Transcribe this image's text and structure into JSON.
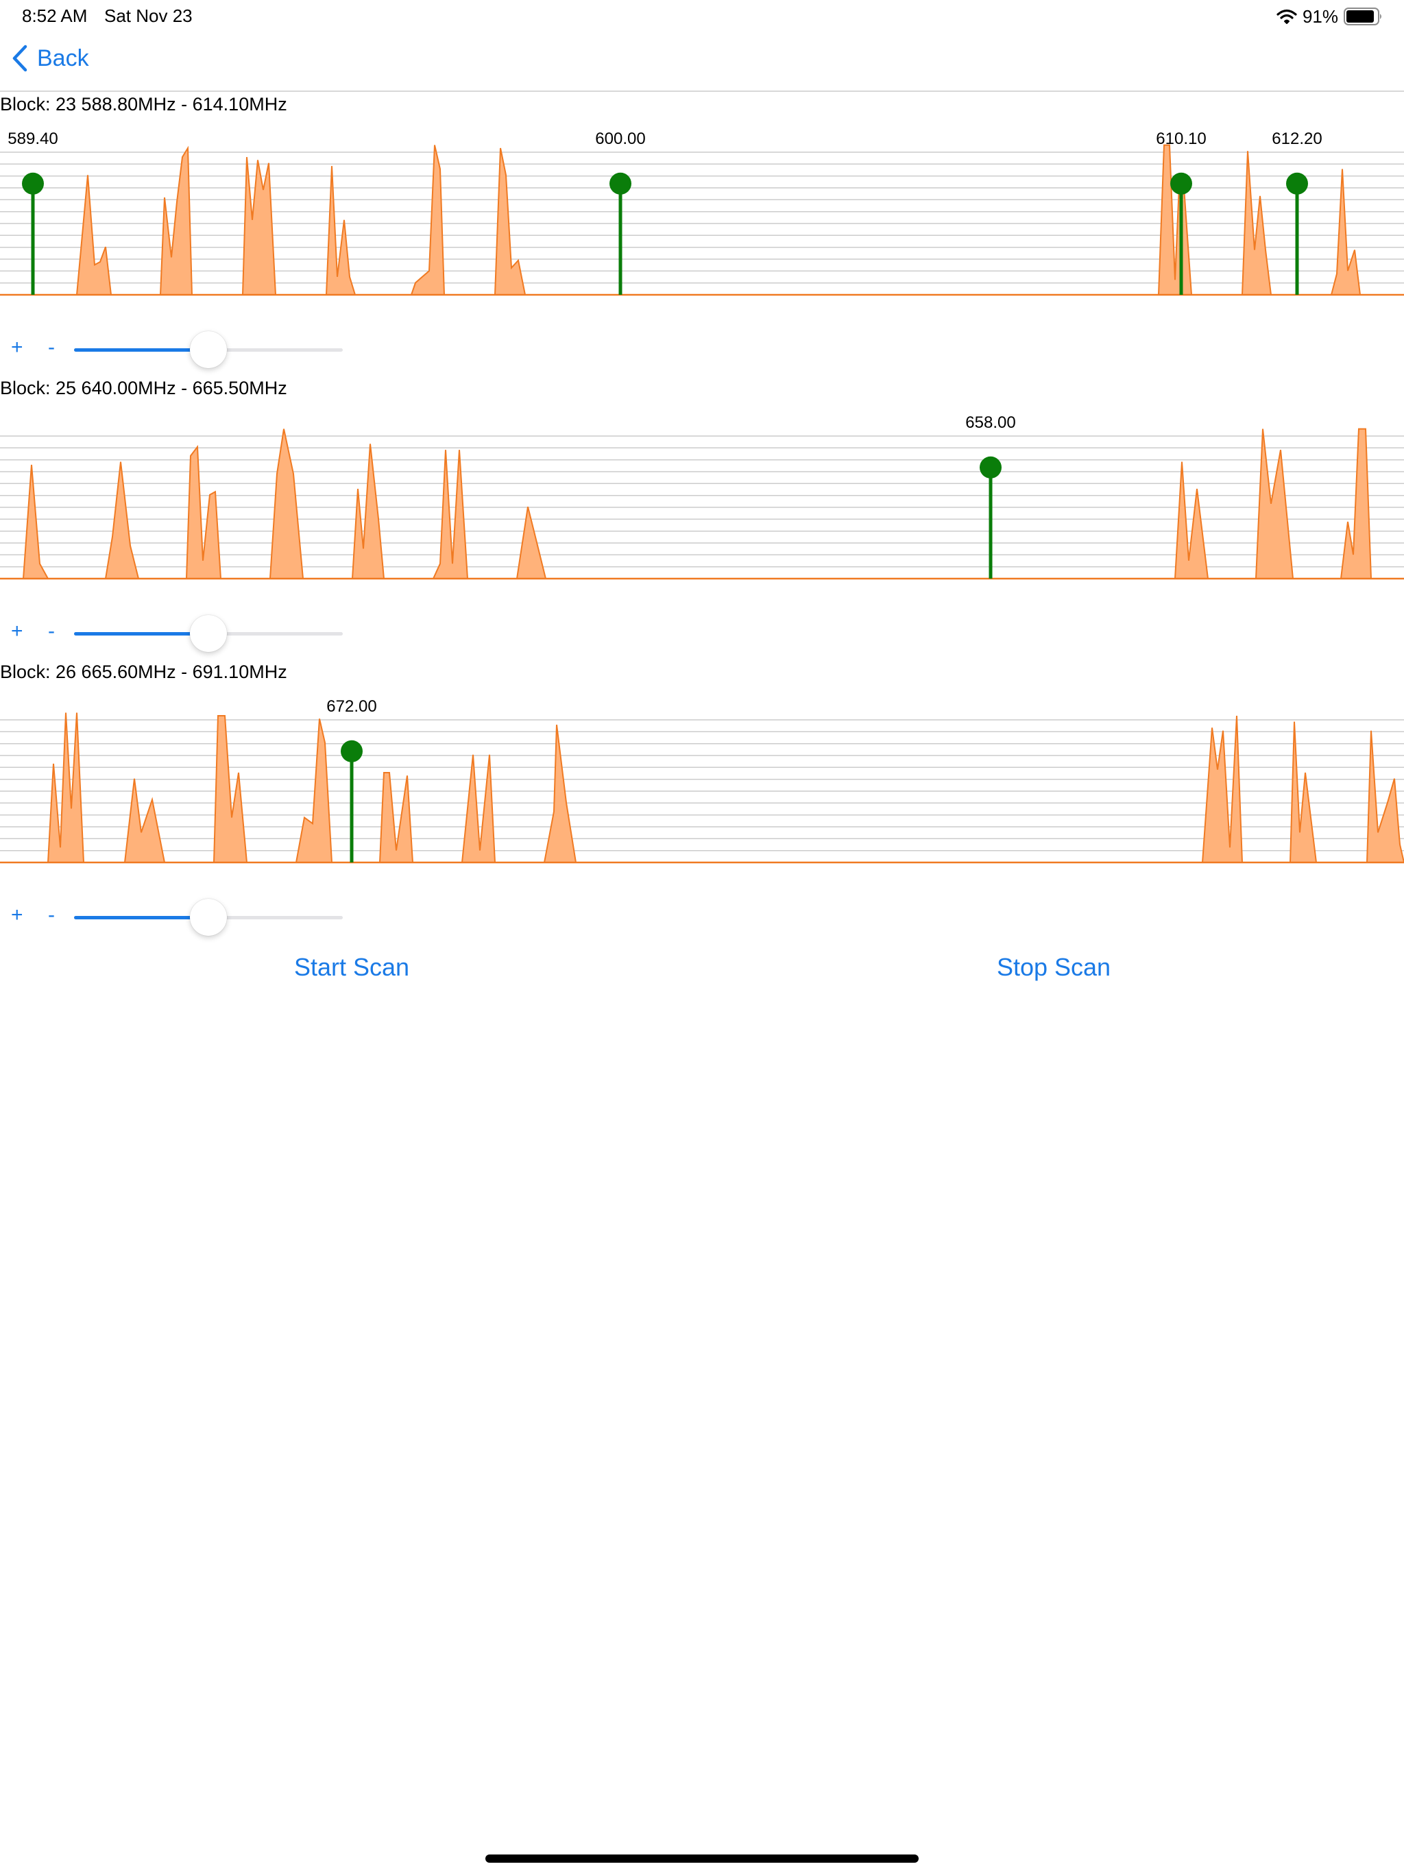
{
  "status_bar": {
    "time": "8:52 AM",
    "date": "Sat Nov 23",
    "battery": "91%",
    "battery_level": 0.91
  },
  "nav": {
    "back_label": "Back"
  },
  "colors": {
    "accent": "#1a7ae6",
    "spectrum_fill": "#ffb27a",
    "spectrum_stroke": "#f07a22",
    "marker": "#0a7d0a",
    "grid": "#cccccc"
  },
  "blocks": [
    {
      "title": "Block: 23 588.80MHz - 614.10MHz",
      "slider_value": 0.5,
      "markers": [
        {
          "label": "589.40",
          "level": 0.78
        },
        {
          "label": "600.00",
          "level": 0.78
        },
        {
          "label": "610.10",
          "level": 0.78
        },
        {
          "label": "612.20",
          "level": 0.78
        }
      ]
    },
    {
      "title": "Block: 25 640.00MHz - 665.50MHz",
      "slider_value": 0.5,
      "markers": [
        {
          "label": "658.00",
          "level": 0.78
        }
      ]
    },
    {
      "title": "Block: 26 665.60MHz - 691.10MHz",
      "slider_value": 0.5,
      "markers": [
        {
          "label": "672.00",
          "level": 0.78
        }
      ]
    }
  ],
  "controls": {
    "zoom_in": "+",
    "zoom_out": "-",
    "start_scan": "Start Scan",
    "stop_scan": "Stop Scan"
  }
}
